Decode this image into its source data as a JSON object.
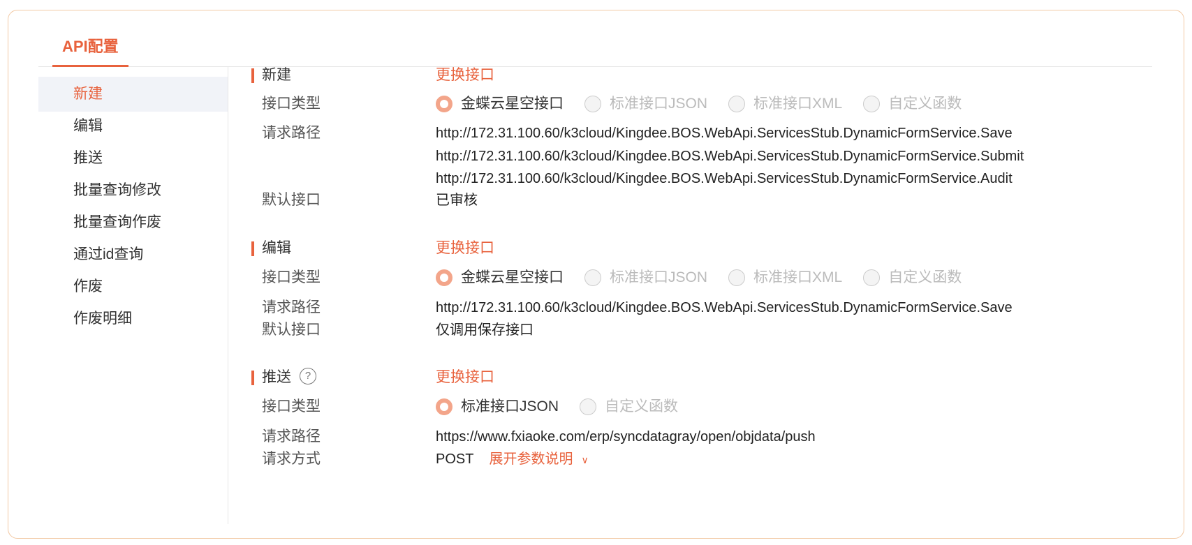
{
  "tab": {
    "label": "API配置"
  },
  "sidebar": {
    "items": [
      {
        "label": "新建"
      },
      {
        "label": "编辑"
      },
      {
        "label": "推送"
      },
      {
        "label": "批量查询修改"
      },
      {
        "label": "批量查询作废"
      },
      {
        "label": "通过id查询"
      },
      {
        "label": "作废"
      },
      {
        "label": "作废明细"
      }
    ]
  },
  "labels": {
    "type": "接口类型",
    "path": "请求路径",
    "default": "默认接口",
    "method": "请求方式",
    "change": "更换接口",
    "expand": "展开参数说明"
  },
  "sections": {
    "create": {
      "title": "新建",
      "options": [
        "金蝶云星空接口",
        "标准接口JSON",
        "标准接口XML",
        "自定义函数"
      ],
      "paths": [
        "http://172.31.100.60/k3cloud/Kingdee.BOS.WebApi.ServicesStub.DynamicFormService.Save",
        "http://172.31.100.60/k3cloud/Kingdee.BOS.WebApi.ServicesStub.DynamicFormService.Submit",
        "http://172.31.100.60/k3cloud/Kingdee.BOS.WebApi.ServicesStub.DynamicFormService.Audit"
      ],
      "default": "已审核"
    },
    "edit": {
      "title": "编辑",
      "options": [
        "金蝶云星空接口",
        "标准接口JSON",
        "标准接口XML",
        "自定义函数"
      ],
      "paths": [
        "http://172.31.100.60/k3cloud/Kingdee.BOS.WebApi.ServicesStub.DynamicFormService.Save"
      ],
      "default": "仅调用保存接口"
    },
    "push": {
      "title": "推送",
      "help_icon": "?",
      "options": [
        "标准接口JSON",
        "自定义函数"
      ],
      "paths": [
        "https://www.fxiaoke.com/erp/syncdatagray/open/objdata/push"
      ],
      "method": "POST"
    }
  },
  "colors": {
    "accent": "#e8623d",
    "frame": "#f2c9a4",
    "active_bg": "#f1f3f8"
  }
}
